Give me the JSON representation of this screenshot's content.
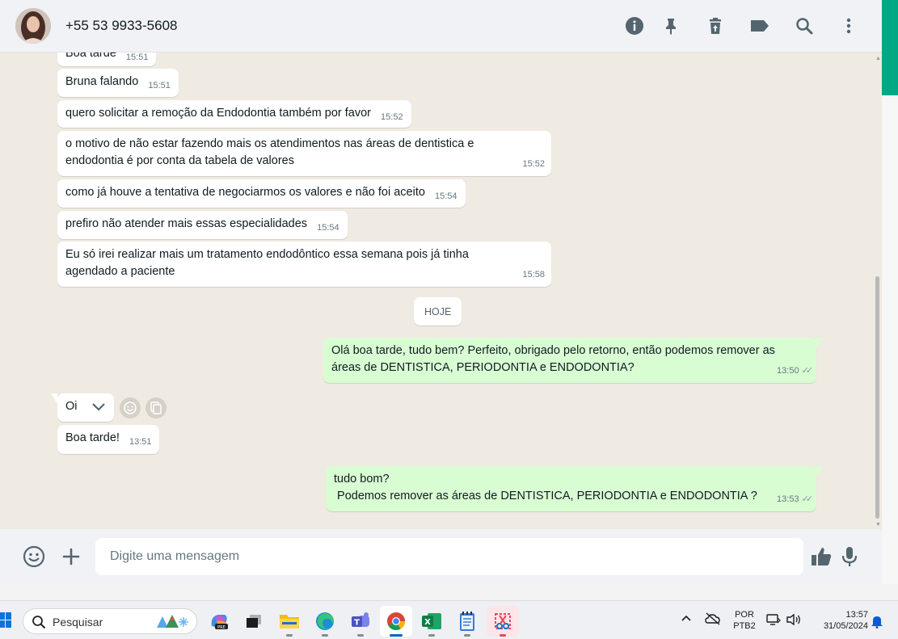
{
  "header": {
    "contact_name": "+55 53 9933-5608",
    "icons": [
      "info-icon",
      "pin-icon",
      "delete-icon",
      "label-icon",
      "search-icon",
      "more-icon"
    ]
  },
  "messages": [
    {
      "dir": "in",
      "text": "Boa tarde",
      "time": "15:51"
    },
    {
      "dir": "in",
      "text": "Bruna falando",
      "time": "15:51"
    },
    {
      "dir": "in",
      "text": "quero solicitar a remoção da Endodontia também por favor",
      "time": "15:52"
    },
    {
      "dir": "in",
      "text_line1": "o motivo de não estar fazendo mais os atendimentos nas áreas de dentistica e",
      "text_line2": "endodontia é por conta da tabela de valores",
      "time": "15:52"
    },
    {
      "dir": "in",
      "text": "como já houve a tentativa de negociarmos os valores e não foi aceito",
      "time": "15:54"
    },
    {
      "dir": "in",
      "text": "prefiro não atender mais essas especialidades",
      "time": "15:54"
    },
    {
      "dir": "in",
      "text_line1": "Eu só irei realizar mais um tratamento endodôntico essa semana pois já tinha",
      "text_line2": "agendado a paciente",
      "time": "15:58"
    },
    {
      "dir": "out",
      "text_line1": "Olá boa tarde, tudo bem? Perfeito, obrigado pelo retorno, então podemos remover as",
      "text_line2": "áreas de DENTISTICA, PERIODONTIA e ENDODONTIA?",
      "time": "13:50"
    },
    {
      "dir": "in",
      "text": "Oi",
      "time": ""
    },
    {
      "dir": "in",
      "text": "Boa tarde!",
      "time": "13:51"
    },
    {
      "dir": "out",
      "text_line1": "tudo bom?",
      "text_line2": " Podemos remover as áreas de DENTISTICA, PERIODONTIA e ENDODONTIA ?",
      "time": "13:53"
    }
  ],
  "day_divider": "HOJE",
  "composer": {
    "placeholder": "Digite uma mensagem"
  },
  "taskbar": {
    "search_label": "Pesquisar",
    "language_line1": "POR",
    "language_line2": "PTB2",
    "clock_time": "13:57",
    "clock_date": "31/05/2024",
    "apps": [
      "copilot-icon",
      "task-view-icon",
      "file-explorer-icon",
      "edge-icon",
      "teams-icon",
      "chrome-icon",
      "excel-icon",
      "notepad-icon",
      "snipping-tool-icon"
    ],
    "active_app": "chrome-icon"
  },
  "colors": {
    "incoming_bubble": "#ffffff",
    "outgoing_bubble": "#d9fdd3",
    "chat_background": "#efeae2",
    "header_background": "#f0f2f5",
    "accent": "#00a884"
  }
}
